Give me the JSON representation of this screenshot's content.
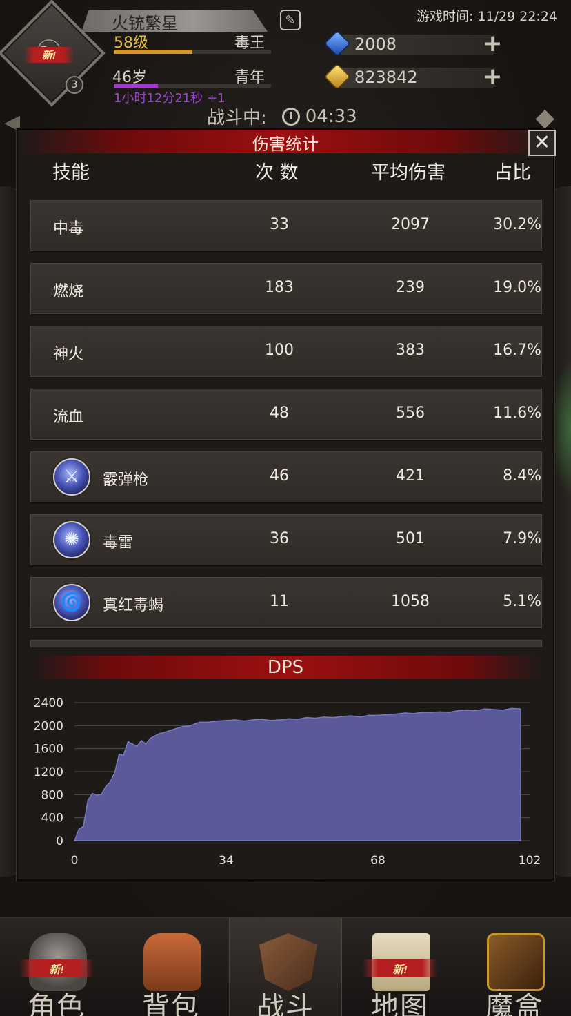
{
  "header": {
    "player_name": "火铳繁星",
    "level": "58级",
    "title": "毒王",
    "age": "46岁",
    "life_stage": "青年",
    "timer": "1小时12分21秒 +1",
    "avatar_badge": "新!",
    "avatar_level": "3",
    "game_time": "游戏时间: 11/29 22:24",
    "xp_fraction": 0.5,
    "age_fraction": 0.28,
    "currency": [
      {
        "icon": "blue-gem-icon",
        "value": "2008"
      },
      {
        "icon": "gold-gem-icon",
        "value": "823842"
      }
    ],
    "battle_label": "战斗中:",
    "battle_timer": "04:33"
  },
  "stats": {
    "title": "伤害统计",
    "columns": {
      "skill": "技能",
      "count": "次 数",
      "avg": "平均伤害",
      "pct": "占比"
    },
    "rows": [
      {
        "name": "中毒",
        "count": "33",
        "avg": "2097",
        "pct": "30.2%",
        "icon": null
      },
      {
        "name": "燃烧",
        "count": "183",
        "avg": "239",
        "pct": "19.0%",
        "icon": null
      },
      {
        "name": "神火",
        "count": "100",
        "avg": "383",
        "pct": "16.7%",
        "icon": null
      },
      {
        "name": "流血",
        "count": "48",
        "avg": "556",
        "pct": "11.6%",
        "icon": null
      },
      {
        "name": "霰弹枪",
        "count": "46",
        "avg": "421",
        "pct": "8.4%",
        "icon": "sword-icon"
      },
      {
        "name": "毒雷",
        "count": "36",
        "avg": "501",
        "pct": "7.9%",
        "icon": "burst-icon"
      },
      {
        "name": "真红毒蝎",
        "count": "11",
        "avg": "1058",
        "pct": "5.1%",
        "icon": "swirl-icon"
      }
    ]
  },
  "dps": {
    "title": "DPS"
  },
  "chart_data": {
    "type": "area",
    "title": "DPS",
    "xlabel": "",
    "ylabel": "",
    "xlim": [
      0,
      102
    ],
    "ylim": [
      0,
      2400
    ],
    "x_ticks": [
      0,
      34,
      68,
      102
    ],
    "y_ticks": [
      0,
      400,
      800,
      1200,
      1600,
      2000,
      2400
    ],
    "grid": true,
    "colors": {
      "fill": "#5a5a9a",
      "line": "#7a7ac0",
      "grid": "#4a4a5a"
    },
    "x": [
      0,
      1,
      2,
      3,
      4,
      5,
      6,
      7,
      8,
      9,
      10,
      11,
      12,
      13,
      14,
      15,
      16,
      17,
      18,
      19,
      20,
      22,
      24,
      26,
      28,
      30,
      32,
      34,
      36,
      38,
      40,
      42,
      44,
      46,
      48,
      50,
      52,
      54,
      56,
      58,
      60,
      62,
      64,
      66,
      68,
      70,
      72,
      74,
      76,
      78,
      80,
      82,
      84,
      86,
      88,
      90,
      92,
      94,
      96,
      98,
      100
    ],
    "values": [
      0,
      200,
      250,
      700,
      820,
      790,
      800,
      940,
      1020,
      1180,
      1500,
      1490,
      1720,
      1680,
      1640,
      1740,
      1680,
      1780,
      1820,
      1860,
      1880,
      1930,
      1980,
      2000,
      2060,
      2060,
      2080,
      2090,
      2100,
      2080,
      2100,
      2110,
      2090,
      2100,
      2120,
      2110,
      2140,
      2130,
      2150,
      2140,
      2160,
      2170,
      2150,
      2180,
      2180,
      2190,
      2200,
      2220,
      2210,
      2230,
      2230,
      2240,
      2230,
      2260,
      2270,
      2260,
      2290,
      2280,
      2270,
      2300,
      2290
    ]
  },
  "nav": {
    "items": [
      {
        "label": "角色",
        "icon": "helmet-icon",
        "badge": "新!"
      },
      {
        "label": "背包",
        "icon": "backpack-icon",
        "badge": ""
      },
      {
        "label": "战斗",
        "icon": "sword-shield-icon",
        "badge": ""
      },
      {
        "label": "地图",
        "icon": "scroll-map-icon",
        "badge": "新!"
      },
      {
        "label": "魔盒",
        "icon": "magic-box-icon",
        "badge": ""
      }
    ],
    "active": "战斗"
  }
}
